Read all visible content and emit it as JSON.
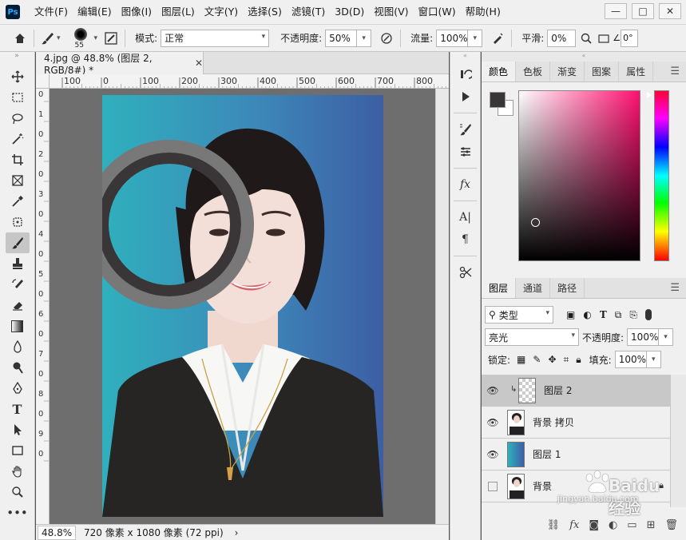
{
  "app": {
    "logo_text": "Ps",
    "menu": [
      "文件(F)",
      "编辑(E)",
      "图像(I)",
      "图层(L)",
      "文字(Y)",
      "选择(S)",
      "滤镜(T)",
      "3D(D)",
      "视图(V)",
      "窗口(W)",
      "帮助(H)"
    ],
    "window_controls": [
      "—",
      "□",
      "✕"
    ]
  },
  "options_bar": {
    "brush_size": "55",
    "mode_label": "模式:",
    "mode_value": "正常",
    "opacity_label": "不透明度:",
    "opacity_value": "50%",
    "flow_label": "流量:",
    "flow_value": "100%",
    "smooth_label": "平滑:",
    "smooth_value": "0%",
    "angle_value": "0°"
  },
  "document": {
    "tab_title": "4.jpg @ 48.8% (图层 2, RGB/8#) *",
    "tab_close": "✕",
    "ruler_labels": [
      "100",
      "0",
      "100",
      "200",
      "300",
      "400",
      "500",
      "600",
      "700",
      "800"
    ],
    "ruler_v_labels": [
      "0",
      "1",
      "0",
      "2",
      "0",
      "3",
      "0",
      "4",
      "0",
      "5",
      "0",
      "6",
      "0",
      "7",
      "0",
      "8",
      "0",
      "9",
      "0"
    ],
    "zoom": "48.8%",
    "status_text": "720 像素 x 1080 像素 (72 ppi)",
    "status_arrow": "›"
  },
  "color_panel": {
    "tabs": [
      "颜色",
      "色板",
      "渐变",
      "图案",
      "属性"
    ],
    "menu_icon": "☰",
    "foreground_color": "#3a3536",
    "background_color": "#ffffff"
  },
  "layers_panel": {
    "tabs": [
      "图层",
      "通道",
      "路径"
    ],
    "filter_label": "类型",
    "blend_mode": "亮光",
    "opacity_label": "不透明度:",
    "opacity_value": "100%",
    "lock_label": "锁定:",
    "fill_label": "填充:",
    "fill_value": "100%",
    "layers": [
      {
        "name": "图层 2",
        "visible": true,
        "selected": true,
        "thumb": "transparent",
        "clipped": true
      },
      {
        "name": "背景 拷贝",
        "visible": true,
        "selected": false,
        "thumb": "portrait"
      },
      {
        "name": "图层 1",
        "visible": true,
        "selected": false,
        "thumb": "gradient"
      },
      {
        "name": "背景",
        "visible": false,
        "selected": false,
        "thumb": "portrait",
        "locked": true
      }
    ],
    "footer_icons": [
      "link-icon",
      "fx-icon",
      "mask-icon",
      "adjustment-icon",
      "folder-icon",
      "new-layer-icon",
      "trash-icon"
    ]
  },
  "watermark": {
    "brand": "Baidu经验",
    "url": "jingyan.baidu.com"
  }
}
